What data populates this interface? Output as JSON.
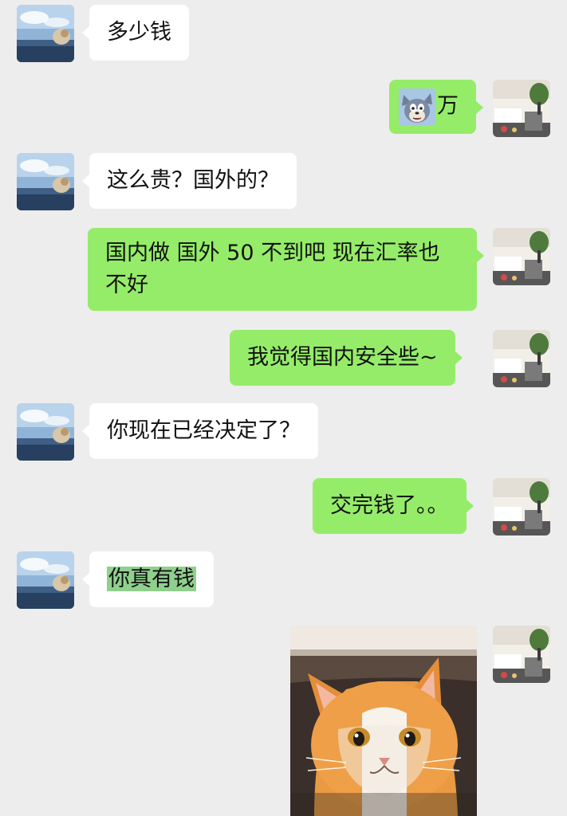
{
  "messages": [
    {
      "side": "left",
      "text": "多少钱"
    },
    {
      "side": "right",
      "sticker": "tom-cat-face-icon",
      "text": "万"
    },
    {
      "side": "left",
      "text": "这么贵？国外的？"
    },
    {
      "side": "right",
      "text": "国内做 国外 50 不到吧 现在汇率也不好"
    },
    {
      "side": "right",
      "text": "我觉得国内安全些~"
    },
    {
      "side": "left",
      "text": "你现在已经决定了？"
    },
    {
      "side": "right",
      "text": "交完钱了。。"
    },
    {
      "side": "left",
      "text": "你真有钱",
      "highlighted": true
    },
    {
      "side": "right",
      "image": "orange-cat-photo"
    }
  ],
  "colors": {
    "background": "#ededed",
    "incoming_bubble": "#ffffff",
    "outgoing_bubble": "#95ec69",
    "selection_highlight": "#8fd08c"
  }
}
